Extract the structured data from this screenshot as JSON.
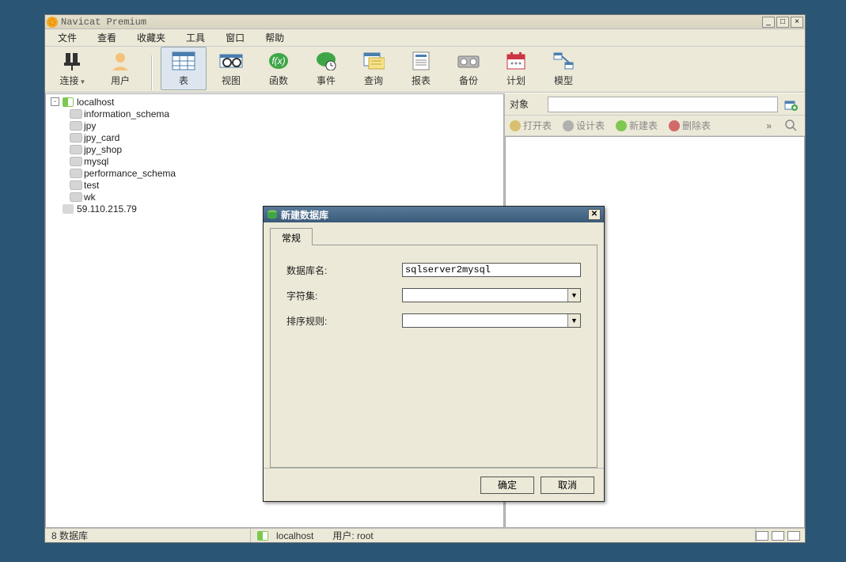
{
  "title": "Navicat Premium",
  "window_buttons": {
    "minimize": "_",
    "maximize": "□",
    "close": "×"
  },
  "menu": [
    "文件",
    "查看",
    "收藏夹",
    "工具",
    "窗口",
    "帮助"
  ],
  "toolbar": [
    {
      "label": "连接",
      "icon": "plug",
      "dropdown": true
    },
    {
      "label": "用户",
      "icon": "user"
    },
    {
      "label": "表",
      "icon": "table",
      "selected": true
    },
    {
      "label": "视图",
      "icon": "view"
    },
    {
      "label": "函数",
      "icon": "function"
    },
    {
      "label": "事件",
      "icon": "event"
    },
    {
      "label": "查询",
      "icon": "query"
    },
    {
      "label": "报表",
      "icon": "report"
    },
    {
      "label": "备份",
      "icon": "backup"
    },
    {
      "label": "计划",
      "icon": "schedule"
    },
    {
      "label": "模型",
      "icon": "model"
    }
  ],
  "tree": {
    "host": "localhost",
    "expander": "-",
    "databases": [
      "information_schema",
      "jpy",
      "jpy_card",
      "jpy_shop",
      "mysql",
      "performance_schema",
      "test",
      "wk"
    ],
    "other_host": "59.110.215.79"
  },
  "rightpane": {
    "object_label": "对象",
    "actions": {
      "open": "打开表",
      "design": "设计表",
      "new": "新建表",
      "delete": "删除表"
    },
    "chev": "»"
  },
  "dialog": {
    "title": "新建数据库",
    "tab": "常规",
    "fields": {
      "db_name_label": "数据库名:",
      "db_name_value": "sqlserver2mysql",
      "charset_label": "字符集:",
      "charset_value": "",
      "collation_label": "排序规则:",
      "collation_value": ""
    },
    "ok": "确定",
    "cancel": "取消"
  },
  "statusbar": {
    "left": "8 数据库",
    "host": "localhost",
    "user": "用户: root"
  }
}
